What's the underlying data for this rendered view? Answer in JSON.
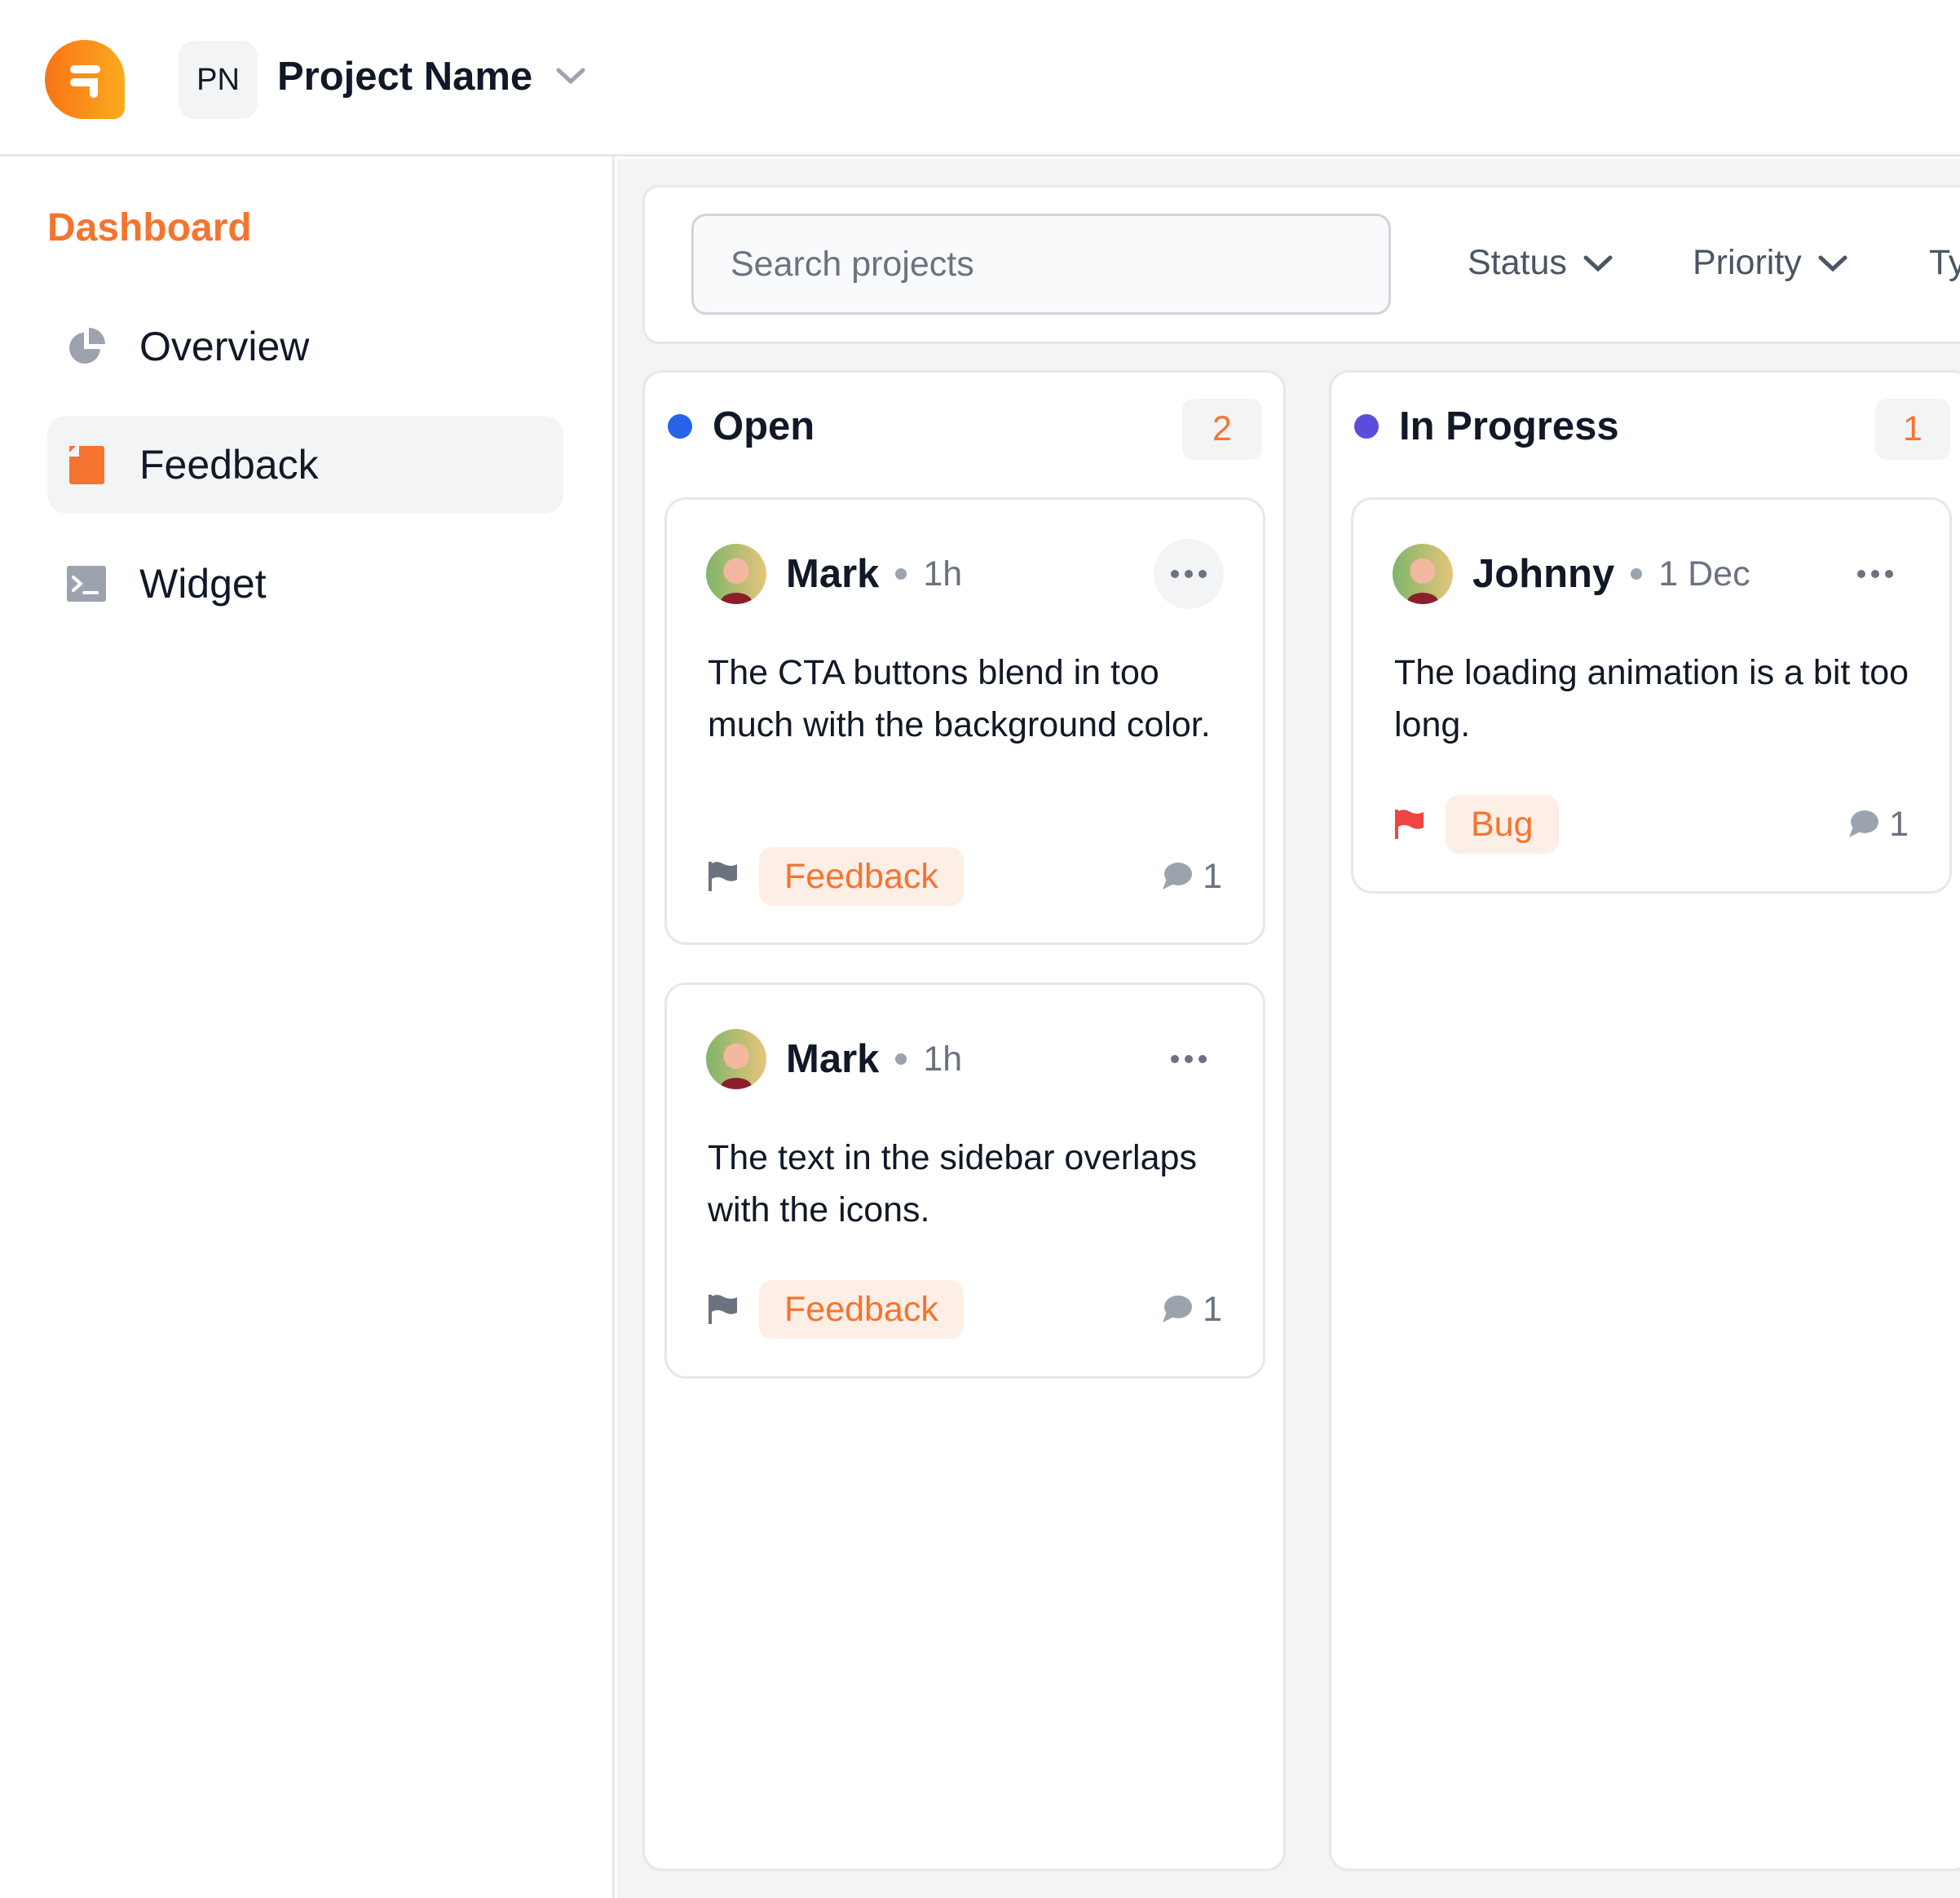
{
  "header": {
    "logo": "feedback-app-logo",
    "project_initials": "PN",
    "project_name": "Project Name"
  },
  "sidebar": {
    "section_title": "Dashboard",
    "items": [
      {
        "label": "Overview",
        "icon": "pie-chart-icon",
        "active": false
      },
      {
        "label": "Feedback",
        "icon": "document-icon",
        "active": true
      },
      {
        "label": "Widget",
        "icon": "terminal-icon",
        "active": false
      }
    ]
  },
  "toolbar": {
    "search_placeholder": "Search projects",
    "filters": [
      "Status",
      "Priority",
      "Ty"
    ]
  },
  "colors": {
    "accent": "#f47430",
    "open": "#2563eb",
    "in_progress": "#5b4cdb",
    "flag_gray": "#6b7280",
    "flag_red": "#ef4444"
  },
  "columns": [
    {
      "title": "Open",
      "count": "2",
      "cards": [
        {
          "user": "Mark",
          "time": "1h",
          "text": "The CTA buttons blend in too much with the background color.",
          "tag": "Feedback",
          "comments": "1",
          "flag": "gray"
        },
        {
          "user": "Mark",
          "time": "1h",
          "text": "The text in the sidebar overlaps with the icons.",
          "tag": "Feedback",
          "comments": "1",
          "flag": "gray"
        }
      ]
    },
    {
      "title": "In Progress",
      "count": "1",
      "cards": [
        {
          "user": "Johnny",
          "time": "1 Dec",
          "text": "The loading animation is a bit too long.",
          "tag": "Bug",
          "comments": "1",
          "flag": "red"
        }
      ]
    }
  ]
}
